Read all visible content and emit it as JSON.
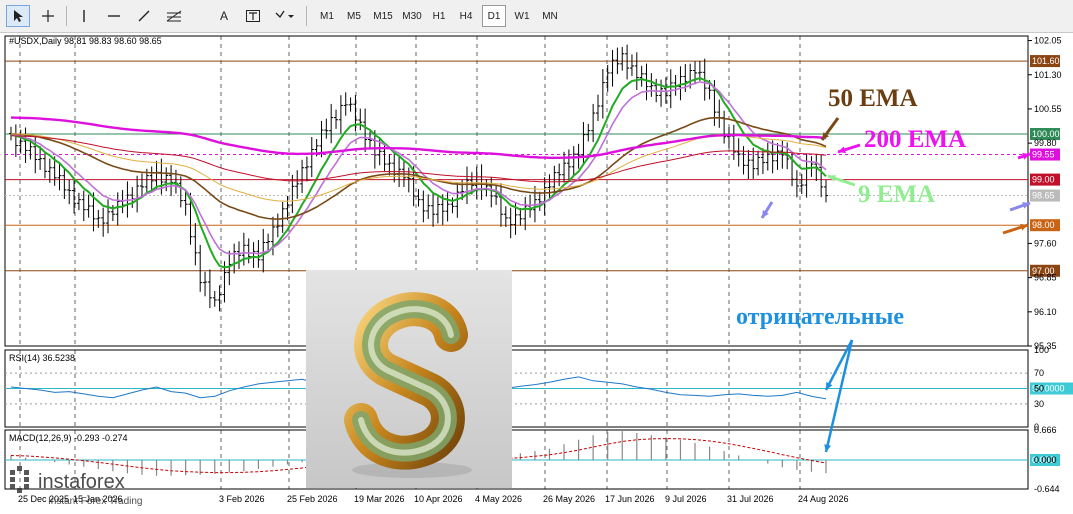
{
  "toolbar": {
    "tools": [
      "cursor-icon",
      "crosshair-icon",
      "vertical-line-icon",
      "horizontal-line-icon",
      "trendline-icon",
      "fibonacci-icon",
      "text-icon",
      "text-label-icon",
      "arrow-shapes-icon"
    ],
    "text_tool_label": "A",
    "timeframes": [
      "M1",
      "M5",
      "M15",
      "M30",
      "H1",
      "H4",
      "D1",
      "W1",
      "MN"
    ],
    "active_timeframe": "D1"
  },
  "main_header": "#USDX,Daily  98.81 98.83 98.60 98.65",
  "rsi_header": "RSI(14) 36.5238",
  "macd_header": "MACD(12,26,9) -0.293 -0.274",
  "annotations": {
    "ema50": "50 EMA",
    "ema200": "200 EMA",
    "ema9": "9 EMA",
    "negative": "отрицательные"
  },
  "logo": {
    "name": "instaforex",
    "tagline": "Instant Forex Trading"
  },
  "colors": {
    "candles": "#000000",
    "ema9": "#22aa22",
    "ema50": "#7a4a16",
    "ema200": "#dd10dd",
    "ema50_label": "#6b3d10",
    "ema200_label": "#ee12ee",
    "ema9_label": "#90ee90",
    "negative_label": "#1e90e0",
    "rsi": "#1f78c8",
    "macd_signal": "#cc0000"
  },
  "chart_data": [
    {
      "type": "line",
      "title": "#USDX,Daily",
      "ohlc_last": {
        "open": 98.81,
        "high": 98.83,
        "low": 98.6,
        "close": 98.65
      },
      "x_ticks": [
        "25 Dec 2025",
        "15 Jan 2026",
        "3 Feb 2026",
        "25 Feb 2026",
        "19 Mar 2026",
        "10 Apr 2026",
        "4 May 2026",
        "26 May 2026",
        "17 Jun 2026",
        "9 Jul 2026",
        "31 Jul 2026",
        "24 Aug 2026"
      ],
      "y_ticks": [
        102.05,
        101.3,
        100.55,
        99.8,
        97.6,
        96.85,
        96.1,
        95.35
      ],
      "ylim": [
        95.35,
        102.15
      ],
      "levels": [
        {
          "value": 101.6,
          "label": "101.60",
          "color": "#8b4513"
        },
        {
          "value": 100.0,
          "label": "100.00",
          "color": "#2e8b57"
        },
        {
          "value": 99.55,
          "label": "99.55",
          "color": "#dd10dd"
        },
        {
          "value": 99.0,
          "label": "99.00",
          "color": "#c0102a"
        },
        {
          "value": 98.65,
          "label": "98.65",
          "color": "#bbbbbb"
        },
        {
          "value": 98.0,
          "label": "98.00",
          "color": "#c86414"
        },
        {
          "value": 97.0,
          "label": "97.00",
          "color": "#8b4513"
        }
      ],
      "series": [
        {
          "name": "Close",
          "values": [
            99.95,
            99.7,
            99.4,
            99.1,
            98.7,
            98.4,
            98.1,
            98.3,
            98.6,
            98.9,
            99.1,
            99.0,
            98.4,
            96.8,
            96.3,
            97.2,
            97.5,
            97.3,
            97.9,
            98.5,
            99.2,
            99.8,
            100.3,
            100.7,
            100.2,
            99.6,
            99.3,
            99.1,
            98.5,
            98.3,
            98.4,
            98.8,
            99.0,
            98.7,
            98.1,
            98.2,
            98.5,
            98.9,
            99.3,
            99.6,
            100.4,
            101.4,
            101.7,
            101.3,
            101.0,
            100.9,
            101.2,
            101.4,
            100.9,
            100.0,
            99.5,
            99.3,
            99.5,
            99.6,
            98.8,
            99.4,
            98.65
          ]
        }
      ]
    },
    {
      "type": "line",
      "title": "RSI(14)",
      "last_value": 36.5238,
      "ylim": [
        0,
        100
      ],
      "y_ticks": [
        100,
        70,
        50,
        30,
        0
      ],
      "levels": [
        {
          "value": 50.0,
          "label": "50.0000"
        }
      ],
      "series": [
        {
          "name": "RSI",
          "values": [
            52,
            50,
            48,
            45,
            46,
            43,
            40,
            38,
            43,
            48,
            52,
            46,
            44,
            38,
            40,
            47,
            52,
            56,
            58,
            60,
            62,
            57,
            60,
            58,
            54,
            52,
            48,
            49,
            45,
            46,
            50,
            53,
            51,
            49,
            50,
            53,
            55,
            58,
            62,
            65,
            60,
            58,
            56,
            52,
            49,
            45,
            42,
            41,
            40,
            42,
            43,
            41,
            40,
            41,
            45,
            40,
            36.5
          ]
        }
      ]
    },
    {
      "type": "bar",
      "title": "MACD(12,26,9)",
      "last_value": -0.293,
      "signal_last": -0.274,
      "ylim": [
        -0.644,
        0.666
      ],
      "y_ticks": [
        0.666,
        0.0,
        -0.644
      ],
      "series": [
        {
          "name": "MACD",
          "values": [
            0.1,
            0.05,
            0.0,
            -0.05,
            -0.1,
            -0.15,
            -0.2,
            -0.25,
            -0.3,
            -0.33,
            -0.35,
            -0.35,
            -0.34,
            -0.33,
            -0.31,
            -0.28,
            -0.25,
            -0.2,
            -0.15,
            -0.1,
            -0.05,
            0.0,
            0.05,
            0.08,
            0.1,
            0.1,
            0.08,
            0.05,
            0.03,
            0.0,
            -0.02,
            -0.02,
            0.0,
            0.05,
            0.1,
            0.15,
            0.2,
            0.25,
            0.35,
            0.45,
            0.55,
            0.62,
            0.64,
            0.6,
            0.55,
            0.5,
            0.45,
            0.38,
            0.3,
            0.2,
            0.1,
            0.0,
            -0.08,
            -0.16,
            -0.22,
            -0.26,
            -0.293
          ]
        }
      ]
    }
  ]
}
